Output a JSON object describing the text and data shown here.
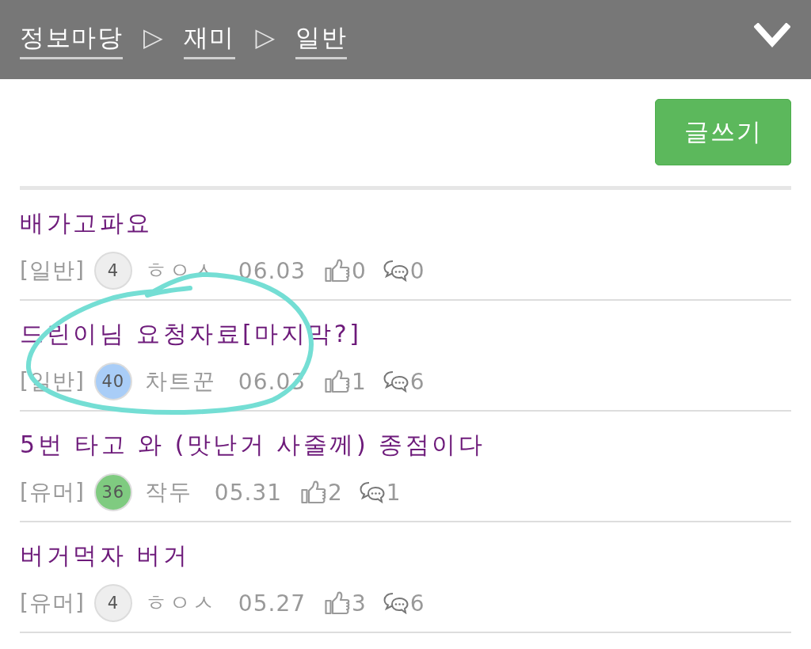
{
  "breadcrumb": [
    {
      "kind": "link",
      "label": "정보마당"
    },
    {
      "kind": "separator",
      "label": "▷"
    },
    {
      "kind": "link",
      "label": "재미"
    },
    {
      "kind": "separator",
      "label": "▷"
    },
    {
      "kind": "link",
      "label": "일반"
    }
  ],
  "write_button": {
    "label": "글쓰기"
  },
  "posts": [
    {
      "title": "배가고파요",
      "category": "[일반]",
      "badge": {
        "text": "4",
        "color": "#eeeeee"
      },
      "author": "ㅎㅇㅅ",
      "date": "06.03",
      "likes": "0",
      "comments": "0",
      "circled": false
    },
    {
      "title": "드린이님 요청자료[마지막?]",
      "category": "[일반]",
      "badge": {
        "text": "40",
        "color": "#a9cdf7"
      },
      "author": "차트꾼",
      "date": "06.03",
      "likes": "1",
      "comments": "6",
      "circled": true
    },
    {
      "title": "5번 타고 와 (맛난거 사줄께) 종점이다",
      "category": "[유머]",
      "badge": {
        "text": "36",
        "color": "#7fcb80"
      },
      "author": "작두",
      "date": "05.31",
      "likes": "2",
      "comments": "1",
      "circled": false
    },
    {
      "title": "버거먹자 버거",
      "category": "[유머]",
      "badge": {
        "text": "4",
        "color": "#eeeeee"
      },
      "author": "ㅎㅇㅅ",
      "date": "05.27",
      "likes": "3",
      "comments": "6",
      "circled": false
    }
  ]
}
